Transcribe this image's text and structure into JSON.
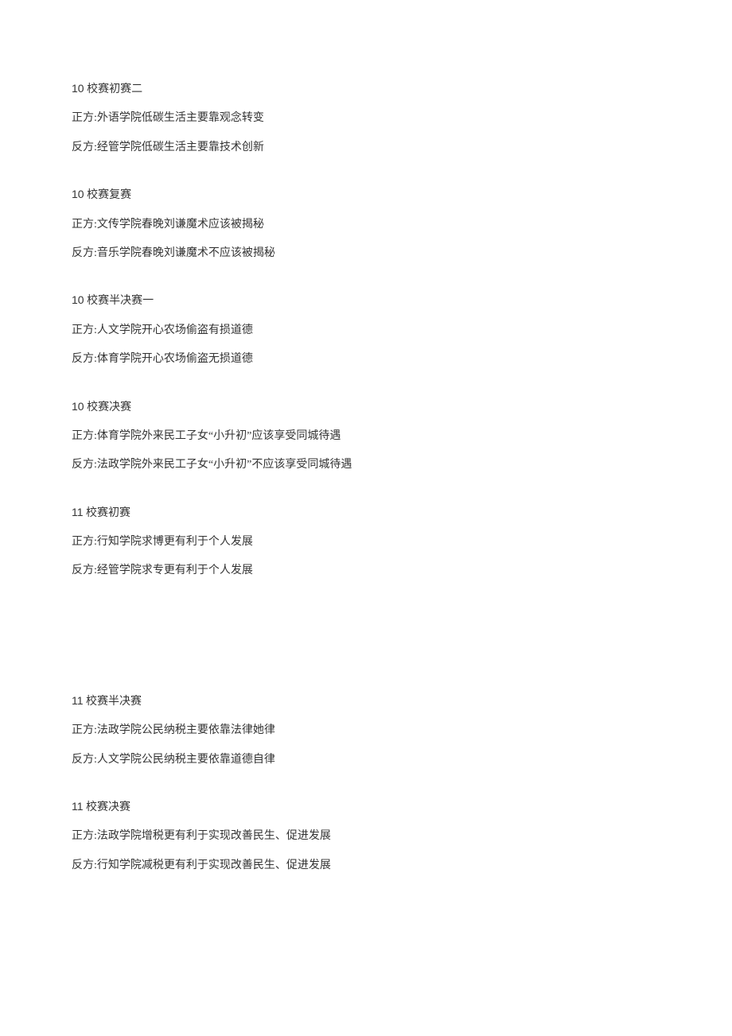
{
  "sections": [
    {
      "title_num": "10",
      "title_rest": " 校赛初赛二",
      "pro": "正方:外语学院低碳生活主要靠观念转变",
      "con": "反方:经管学院低碳生活主要靠技术创新"
    },
    {
      "title_num": "10",
      "title_rest": " 校赛复赛",
      "pro": "正方:文传学院春晚刘谦魔术应该被揭秘",
      "con": "反方:音乐学院春晚刘谦魔术不应该被揭秘"
    },
    {
      "title_num": "10",
      "title_rest": " 校赛半决赛一",
      "pro": "正方:人文学院开心农场偷盗有损道德",
      "con": "反方:体育学院开心农场偷盗无损道德"
    },
    {
      "title_num": "10",
      "title_rest": " 校赛决赛",
      "pro": "正方:体育学院外来民工子女“小升初”应该享受同城待遇",
      "con": "反方:法政学院外来民工子女“小升初”不应该享受同城待遇"
    },
    {
      "title_num": "11",
      "title_rest": " 校赛初赛",
      "pro": "正方:行知学院求博更有利于个人发展",
      "con": "反方:经管学院求专更有利于个人发展"
    },
    {
      "title_num": "11",
      "title_rest": " 校赛半决赛",
      "pro": "正方:法政学院公民纳税主要依靠法律她律",
      "con": "反方:人文学院公民纳税主要依靠道德自律"
    },
    {
      "title_num": "11",
      "title_rest": " 校赛决赛",
      "pro": "正方:法政学院增税更有利于实现改善民生、促进发展",
      "con": "反方:行知学院减税更有利于实现改善民生、促进发展"
    }
  ]
}
